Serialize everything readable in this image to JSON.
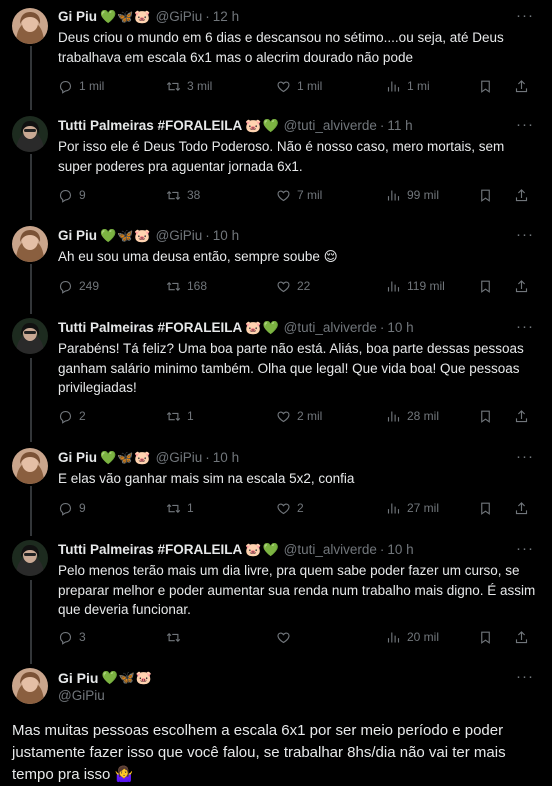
{
  "tweets": [
    {
      "name": "Gi Piu",
      "emojis": "💚🦋🐷",
      "handle": "@GiPiu",
      "time": "12 h",
      "text": "Deus criou o mundo em 6 dias e descansou no sétimo....ou seja, até Deus trabalhava em escala 6x1 mas o alecrim dourado não pode",
      "replies": "1 mil",
      "retweets": "3 mil",
      "likes": "1 mil",
      "views": "1 mi",
      "avatar": "gipiu"
    },
    {
      "name": "Tutti Palmeiras #FORALEILA",
      "emojis": "🐷💚",
      "handle": "@tuti_alviverde",
      "time": "11 h",
      "text": "Por isso ele é Deus Todo Poderoso. Não é nosso caso, mero mortais, sem super poderes pra aguentar jornada 6x1.",
      "replies": "9",
      "retweets": "38",
      "likes": "7 mil",
      "views": "99 mil",
      "avatar": "tutti"
    },
    {
      "name": "Gi Piu",
      "emojis": "💚🦋🐷",
      "handle": "@GiPiu",
      "time": "10 h",
      "text": "Ah eu sou uma deusa então, sempre soube 😌",
      "replies": "249",
      "retweets": "168",
      "likes": "22",
      "views": "119 mil",
      "avatar": "gipiu"
    },
    {
      "name": "Tutti Palmeiras #FORALEILA",
      "emojis": "🐷💚",
      "handle": "@tuti_alviverde",
      "time": "10 h",
      "text": "Parabéns! Tá feliz? Uma boa parte não está. Aliás, boa parte dessas pessoas ganham salário minimo também. Olha que legal! Que vida boa! Que pessoas privilegiadas!",
      "replies": "2",
      "retweets": "1",
      "likes": "2 mil",
      "views": "28 mil",
      "avatar": "tutti"
    },
    {
      "name": "Gi Piu",
      "emojis": "💚🦋🐷",
      "handle": "@GiPiu",
      "time": "10 h",
      "text": "E elas vão ganhar mais sim na escala 5x2, confia",
      "replies": "9",
      "retweets": "1",
      "likes": "2",
      "views": "27 mil",
      "avatar": "gipiu"
    },
    {
      "name": "Tutti Palmeiras #FORALEILA",
      "emojis": "🐷💚",
      "handle": "@tuti_alviverde",
      "time": "10 h",
      "text": "Pelo menos terão mais um dia livre, pra quem sabe poder fazer um curso, se preparar melhor e poder aumentar sua renda num trabalho mais digno. É assim que deveria funcionar.",
      "replies": "3",
      "retweets": "",
      "likes": "",
      "views": "20 mil",
      "avatar": "tutti"
    }
  ],
  "main": {
    "name": "Gi Piu",
    "emojis": "💚🦋🐷",
    "handle": "@GiPiu",
    "text": "Mas muitas pessoas escolhem a escala 6x1 por ser meio período e poder justamente fazer isso que você falou, se trabalhar 8hs/dia não vai ter mais tempo pra isso 🤷‍♀️"
  },
  "ui": {
    "dot": "·",
    "more": "···"
  },
  "colors": {
    "background": "#000000",
    "text": "#e7e9ea",
    "muted": "#71767b",
    "border": "#2f3336"
  }
}
